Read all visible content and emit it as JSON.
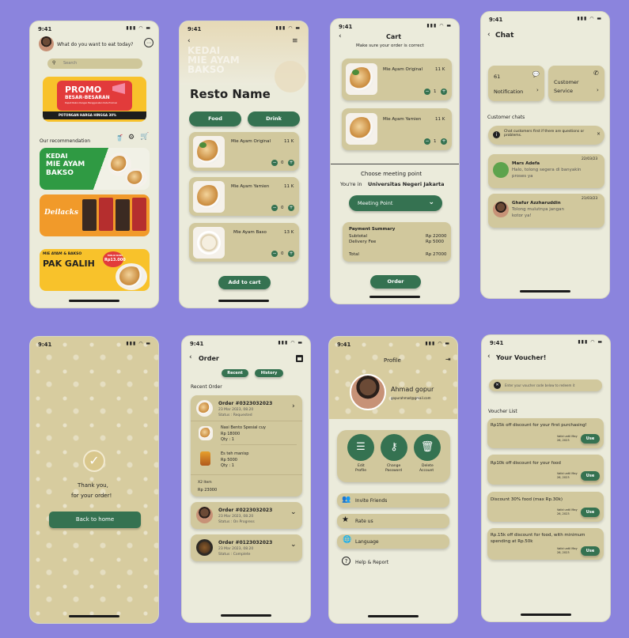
{
  "status_time": "9:41",
  "home": {
    "question": "What do you want to eat today?",
    "search_placeholder": "Search",
    "promo_line1": "PROMO",
    "promo_line2": "BESAR-BESARAN",
    "promo_small": "Dapat Diskon Dengan Menggunakan Kode Promosi",
    "promo_bottom": "POTONGAN HARGA HINGGA 30%",
    "recommendation_title": "Our recommendation",
    "banner1_line1": "KEDAI",
    "banner1_line2": "MIE AYAM",
    "banner1_line3": "BAKSO",
    "banner2_text": "Deilacks",
    "banner3_line1": "MIE AYAM & BAKSO",
    "banner3_line2": "PAK GALIH",
    "banner3_price_label": "MULAI DARI",
    "banner3_price": "Rp13.000"
  },
  "resto": {
    "bg_text": [
      "KEDAI",
      "MIE AYAM",
      "BAKSO"
    ],
    "name": "Resto Name",
    "tab_food": "Food",
    "tab_drink": "Drink",
    "items": [
      {
        "name": "Mie Ayam Original",
        "price": "11 K",
        "qty": "0"
      },
      {
        "name": "Mie Ayam Yamien",
        "price": "11 K",
        "qty": "0"
      },
      {
        "name": "Mie Ayam Baso",
        "price": "13 K",
        "qty": "0"
      }
    ],
    "add_button": "Add to cart"
  },
  "cart": {
    "title": "Cart",
    "subtitle": "Make sure your order is correct",
    "items": [
      {
        "name": "Mie Ayam Original",
        "price": "11 K",
        "qty": "1"
      },
      {
        "name": "Mie Ayam Yamien",
        "price": "11 K",
        "qty": "1"
      }
    ],
    "meeting_title": "Choose meeting point",
    "location_prefix": "You're in",
    "location": "Universitas Negeri Jakarta",
    "meeting_dropdown": "Meeting Point",
    "summary_title": "Payment Summary",
    "subtotal_label": "Subtotal",
    "subtotal_value": "Rp 22000",
    "delivery_label": "Delivery Fee",
    "delivery_value": "Rp  5000",
    "total_label": "Total",
    "total_value": "Rp 27000",
    "order_button": "Order"
  },
  "chat": {
    "title": "Chat",
    "notif_count": "61",
    "notif_label": "Notification",
    "service_label1": "Customer",
    "service_label2": "Service",
    "section": "Customer chats",
    "info": "Chat customers first if there are questions or problems.",
    "chats": [
      {
        "name": "Mars Adefa",
        "date": "22/03/23",
        "msg1": "Halo, tolong segera di banyakin",
        "msg2": "proses ya"
      },
      {
        "name": "Ghafur Azzharuddin",
        "date": "21/03/23",
        "msg1": "Tolong mulutnya jangan",
        "msg2": "kotor ya!"
      }
    ]
  },
  "thanks": {
    "line1": "Thank you,",
    "line2": "for your order!",
    "button": "Back to home"
  },
  "order": {
    "title": "Order",
    "tab_recent": "Recent",
    "tab_history": "History",
    "section": "Recent Order",
    "o1_title": "Order #0323032023",
    "o1_date": "23 Mar 2023, 08.20",
    "o1_status": "Status : Requested",
    "o1_item1_name": "Nasi Bento Spesial cuy",
    "o1_item1_price": "Rp 18000",
    "o1_item1_qty": "Qty : 1",
    "o1_item2_name": "Es teh manisp",
    "o1_item2_price": "Rp 5000",
    "o1_item2_qty": "Qty : 1",
    "o1_count": "X2 Item",
    "o1_total": "Rp 23000",
    "o2_title": "Order #0223032023",
    "o2_date": "23 Mar 2023, 08.20",
    "o2_status": "Status : On Progress",
    "o3_title": "Order #0123032023",
    "o3_date": "23 Mar 2023, 08.20",
    "o3_status": "Status : Complete"
  },
  "profile": {
    "title": "Profile",
    "name": "Ahmad gopur",
    "email": "gopurahmad@gmail.com",
    "edit_label1": "Edit",
    "edit_label2": "Profile",
    "pass_label1": "Change",
    "pass_label2": "Password",
    "del_label1": "Delete",
    "del_label2": "Account",
    "menu": [
      "Invite Friends",
      "Rate us",
      "Language",
      "Help & Report"
    ]
  },
  "voucher": {
    "title": "Your Voucher!",
    "placeholder": "Enter your voucher code below to redeem it",
    "list_title": "Voucher List",
    "items": [
      {
        "text": "Rp15k off discount for your first purchasing!",
        "valid1": "Valid until May",
        "valid2": "26, 2023",
        "button": "Use"
      },
      {
        "text": "Rp10k off discount for your food",
        "valid1": "Valid until May",
        "valid2": "26, 2023",
        "button": "Use"
      },
      {
        "text": "Discount 30% food (max Rp.30k)",
        "valid1": "Valid until May",
        "valid2": "26, 2023",
        "button": "Use"
      },
      {
        "text": "Rp.15k off discount for food, with minimum",
        "text2": "spending at Rp.50k",
        "valid1": "Valid until May",
        "valid2": "26, 2023",
        "button": "Use"
      }
    ]
  },
  "colors": {
    "background": "#8b84dd",
    "screen": "#ebebdb",
    "card": "#d1c89d",
    "accent": "#357251"
  }
}
